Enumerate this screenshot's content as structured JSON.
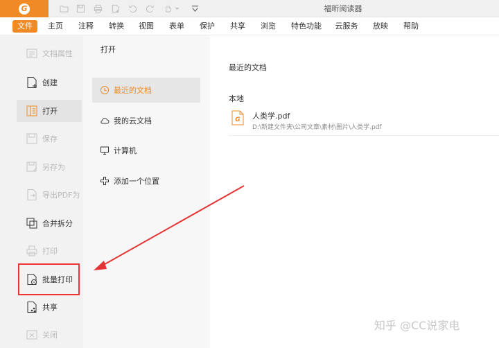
{
  "app": {
    "window_title": "福昕阅读器",
    "logo_letter": "G",
    "accent": "#f08a24"
  },
  "quick_access": [
    {
      "name": "open-folder-icon"
    },
    {
      "name": "save-icon"
    },
    {
      "name": "print-icon"
    },
    {
      "name": "new-file-icon"
    },
    {
      "name": "undo-icon"
    },
    {
      "name": "redo-icon"
    },
    {
      "name": "hand-tool-icon"
    },
    {
      "name": "customize-dropdown-icon"
    }
  ],
  "menu": {
    "items": [
      "文件",
      "主页",
      "注释",
      "转换",
      "视图",
      "表单",
      "保护",
      "共享",
      "浏览",
      "特色功能",
      "云服务",
      "放映",
      "帮助"
    ],
    "active": "文件"
  },
  "left_menu": [
    {
      "label": "文档属性",
      "icon": "document-properties-icon",
      "state": "disabled"
    },
    {
      "label": "创建",
      "icon": "create-icon",
      "state": "normal"
    },
    {
      "label": "打开",
      "icon": "open-icon",
      "state": "selected"
    },
    {
      "label": "保存",
      "icon": "save-icon",
      "state": "disabled"
    },
    {
      "label": "另存为",
      "icon": "save-as-icon",
      "state": "disabled"
    },
    {
      "label": "导出PDF为",
      "icon": "export-pdf-icon",
      "state": "disabled"
    },
    {
      "label": "合并拆分",
      "icon": "merge-split-icon",
      "state": "normal"
    },
    {
      "label": "打印",
      "icon": "print-icon",
      "state": "disabled"
    },
    {
      "label": "批量打印",
      "icon": "batch-print-icon",
      "state": "highlighted"
    },
    {
      "label": "共享",
      "icon": "share-icon",
      "state": "normal"
    },
    {
      "label": "关闭",
      "icon": "close-icon",
      "state": "disabled"
    }
  ],
  "open_panel": {
    "title": "打开",
    "items": [
      {
        "label": "最近的文档",
        "icon": "clock-icon",
        "selected": true
      },
      {
        "label": "我的云文档",
        "icon": "cloud-icon",
        "selected": false
      },
      {
        "label": "计算机",
        "icon": "computer-icon",
        "selected": false
      },
      {
        "label": "添加一个位置",
        "icon": "add-location-icon",
        "selected": false
      }
    ]
  },
  "recent": {
    "heading": "最近的文档",
    "section_label": "本地",
    "files": [
      {
        "name": "人类学.pdf",
        "path": "D:\\新建文件夹\\公司文章\\素材\\图片\\人类学.pdf",
        "icon": "pdf-file-icon"
      }
    ]
  },
  "watermark": "知乎 @CC说家电",
  "annotation": {
    "color": "#e33333"
  }
}
